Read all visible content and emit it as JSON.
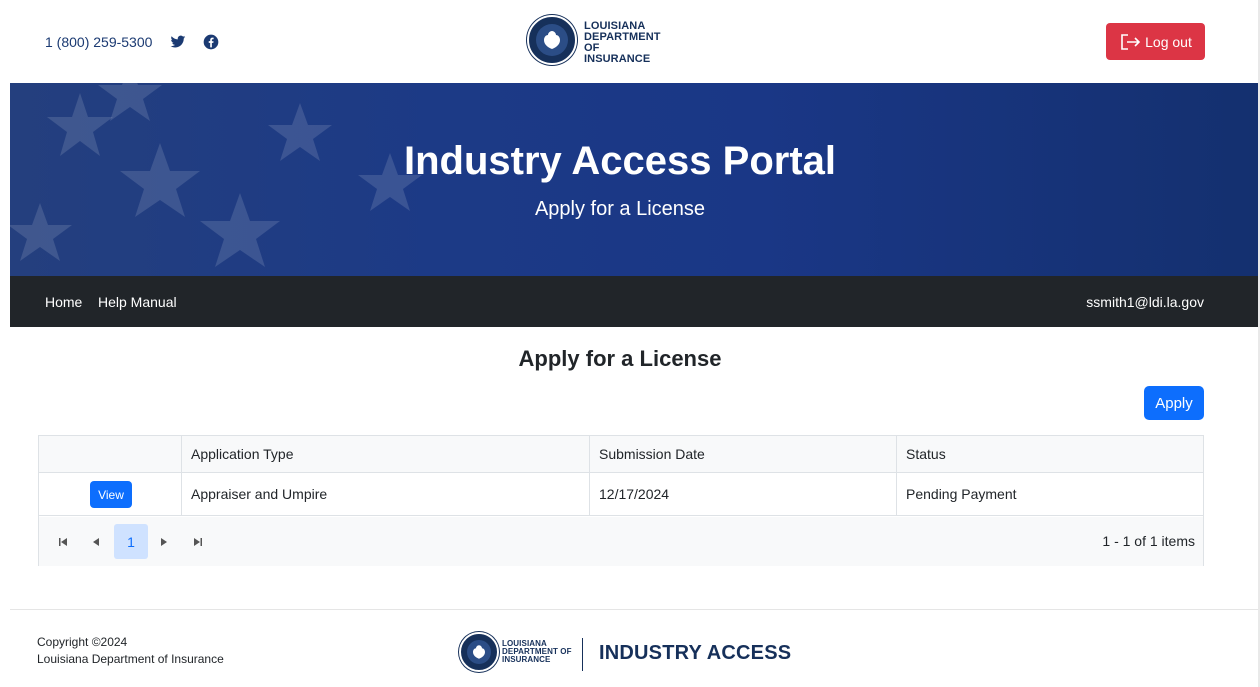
{
  "header": {
    "phone": "1 (800) 259-5300",
    "social_icons": [
      "twitter-icon",
      "facebook-icon"
    ],
    "logo_text": [
      "LOUISIANA",
      "DEPARTMENT OF",
      "INSURANCE"
    ],
    "logout_label": "Log out"
  },
  "hero": {
    "title": "Industry Access Portal",
    "subtitle": "Apply for a License"
  },
  "nav": {
    "items": [
      {
        "label": "Home"
      },
      {
        "label": "Help Manual"
      }
    ],
    "user": "ssmith1@ldi.la.gov"
  },
  "main": {
    "title": "Apply for a License",
    "apply_label": "Apply",
    "table": {
      "columns": [
        "",
        "Application Type",
        "Submission Date",
        "Status"
      ],
      "rows": [
        {
          "action": "View",
          "application_type": "Appraiser and Umpire",
          "submission_date": "12/17/2024",
          "status": "Pending Payment"
        }
      ]
    },
    "pager": {
      "current_page": "1",
      "info": "1 - 1 of 1 items"
    }
  },
  "footer": {
    "copyright": "Copyright ©2024",
    "org": "Louisiana Department of Insurance",
    "logo_text": [
      "LOUISIANA",
      "DEPARTMENT OF",
      "INSURANCE"
    ],
    "brand": "INDUSTRY ACCESS"
  },
  "colors": {
    "brand_navy": "#16305a",
    "danger": "#dc3545",
    "primary": "#0d6efd",
    "navbar": "#212529"
  }
}
